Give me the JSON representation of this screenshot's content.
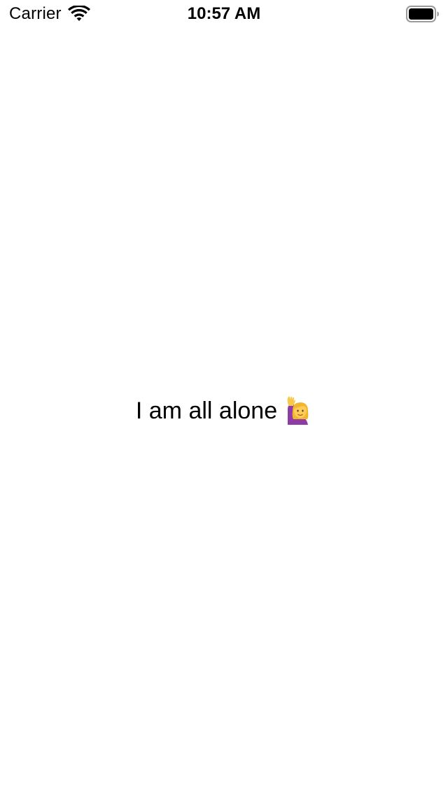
{
  "status_bar": {
    "carrier": "Carrier",
    "time": "10:57 AM",
    "icons": {
      "wifi": "wifi-icon",
      "battery": "battery-icon"
    }
  },
  "main": {
    "message": "I am all alone",
    "emoji_icon": "raising-hand-icon"
  },
  "colors": {
    "background": "#ffffff",
    "text": "#000000"
  }
}
